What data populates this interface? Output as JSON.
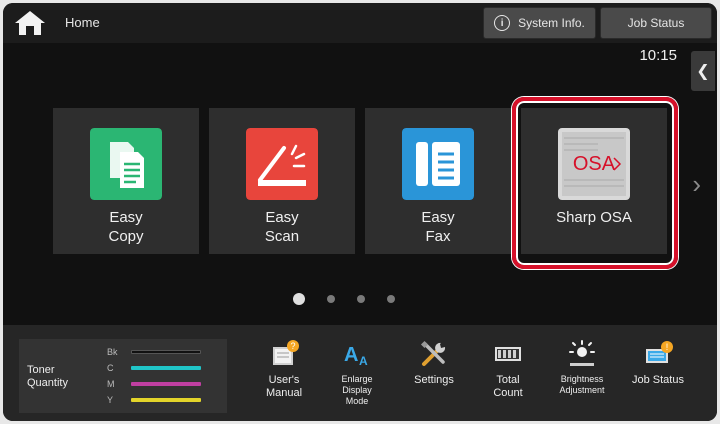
{
  "topbar": {
    "home_label": "Home",
    "system_info_label": "System Info.",
    "job_status_label": "Job Status"
  },
  "clock": "10:15",
  "tiles": [
    {
      "label": "Easy\nCopy",
      "color": "#2bb673"
    },
    {
      "label": "Easy\nScan",
      "color": "#e8453c"
    },
    {
      "label": "Easy\nFax",
      "color": "#2a95d8"
    },
    {
      "label": "Sharp OSA",
      "logo_text": "OSA"
    }
  ],
  "pager": {
    "pages": 4,
    "current": 1
  },
  "toner": {
    "label": "Toner\nQuantity",
    "rows": [
      {
        "name": "Bk",
        "color": "#111111"
      },
      {
        "name": "C",
        "color": "#20c5c8"
      },
      {
        "name": "M",
        "color": "#c03fa2"
      },
      {
        "name": "Y",
        "color": "#e3d42a"
      }
    ]
  },
  "shortcuts": {
    "manual": "User's\nManual",
    "enlarge": "Enlarge\nDisplay\nMode",
    "settings": "Settings",
    "total_count": "Total\nCount",
    "brightness": "Brightness\nAdjustment",
    "job_status": "Job Status"
  },
  "colors": {
    "highlight": "#d6112a",
    "badge": "#f5a623"
  }
}
